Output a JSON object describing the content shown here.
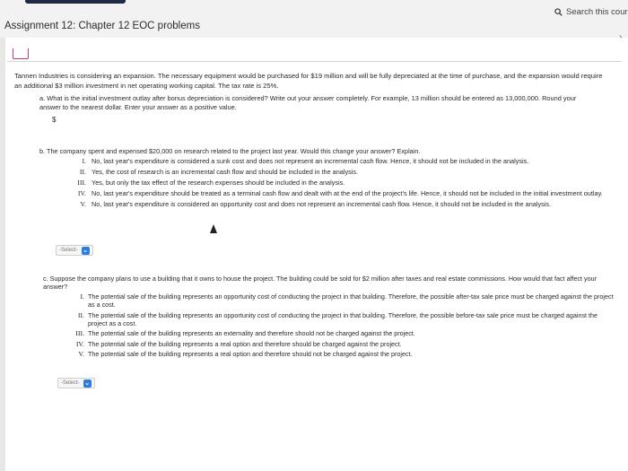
{
  "header": {
    "assignment_title": "Assignment 12: Chapter 12 EOC problems",
    "search_label": "Search this cours"
  },
  "intro": "Tannen Industries is considering an expansion. The necessary equipment would be purchased for $19 million and will be fully depreciated at the time of purchase, and the expansion would require an additional $3 million investment in net operating working capital. The tax rate is 25%.",
  "part_a": {
    "letter": "a.",
    "question": "What is the initial investment outlay after bonus depreciation is considered? Write out your answer completely. For example, 13 million should be entered as 13,000,000. Round your answer to the nearest dollar. Enter your answer as a positive value.",
    "currency": "$",
    "answer_value": ""
  },
  "part_b": {
    "letter": "b.",
    "question": "The company spent and expensed $20,000 on research related to the project last year. Would this change your answer? Explain.",
    "options": [
      {
        "num": "I.",
        "text": "No, last year's expenditure is considered a sunk cost and does not represent an incremental cash flow. Hence, it should not be included in the analysis."
      },
      {
        "num": "II.",
        "text": "Yes, the cost of research is an incremental cash flow and should be included in the analysis."
      },
      {
        "num": "III.",
        "text": "Yes, but only the tax effect of the research expenses should be included in the analysis."
      },
      {
        "num": "IV.",
        "text": "No, last year's expenditure should be treated as a terminal cash flow and dealt with at the end of the project's life. Hence, it should not be included in the initial investment outlay."
      },
      {
        "num": "V.",
        "text": "No, last year's expenditure is considered an opportunity cost and does not represent an incremental cash flow. Hence, it should not be included in the analysis."
      }
    ],
    "select_label": "-Select-"
  },
  "part_c": {
    "letter": "c.",
    "question": "Suppose the company plans to use a building that it owns to house the project. The building could be sold for $2 million after taxes and real estate commissions. How would that fact affect your answer?",
    "options": [
      {
        "num": "I.",
        "text": "The potential sale of the building represents an opportunity cost of conducting the project in that building. Therefore, the possible after-tax sale price must be charged against the project as a cost."
      },
      {
        "num": "II.",
        "text": "The potential sale of the building represents an opportunity cost of conducting the project in that building. Therefore, the possible before-tax sale price must be charged against the project as a cost."
      },
      {
        "num": "III.",
        "text": "The potential sale of the building represents an externality and therefore should not be charged against the project."
      },
      {
        "num": "IV.",
        "text": "The potential sale of the building represents a real option and therefore should be charged against the project."
      },
      {
        "num": "V.",
        "text": "The potential sale of the building represents a real option and therefore should not be charged against the project."
      }
    ],
    "select_label": "-Select-"
  },
  "colors": {
    "accent_blue": "#2b7de0",
    "module_icon": "#c43b6f",
    "brand_dark": "#1e2a44"
  }
}
